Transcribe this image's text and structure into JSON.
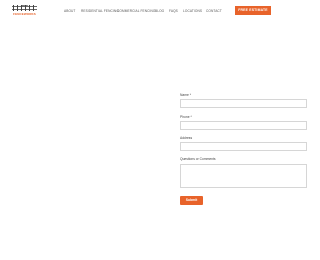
{
  "brand": {
    "name": "FENCEWORKS",
    "accent_color": "#e8632a",
    "logo_icon": "fence-gate-logo-icon"
  },
  "nav": {
    "items": [
      "ABOUT",
      "RESIDENTIAL FENCING",
      "COMMERCIAL FENCING",
      "BLOG",
      "FAQS",
      "LOCATIONS",
      "CONTACT"
    ]
  },
  "cta": {
    "label": "FREE ESTIMATE"
  },
  "form": {
    "name_label": "Name *",
    "phone_label": "Phone *",
    "address_label": "Address",
    "comments_label": "Questions or Comments",
    "submit_label": "Submit"
  }
}
